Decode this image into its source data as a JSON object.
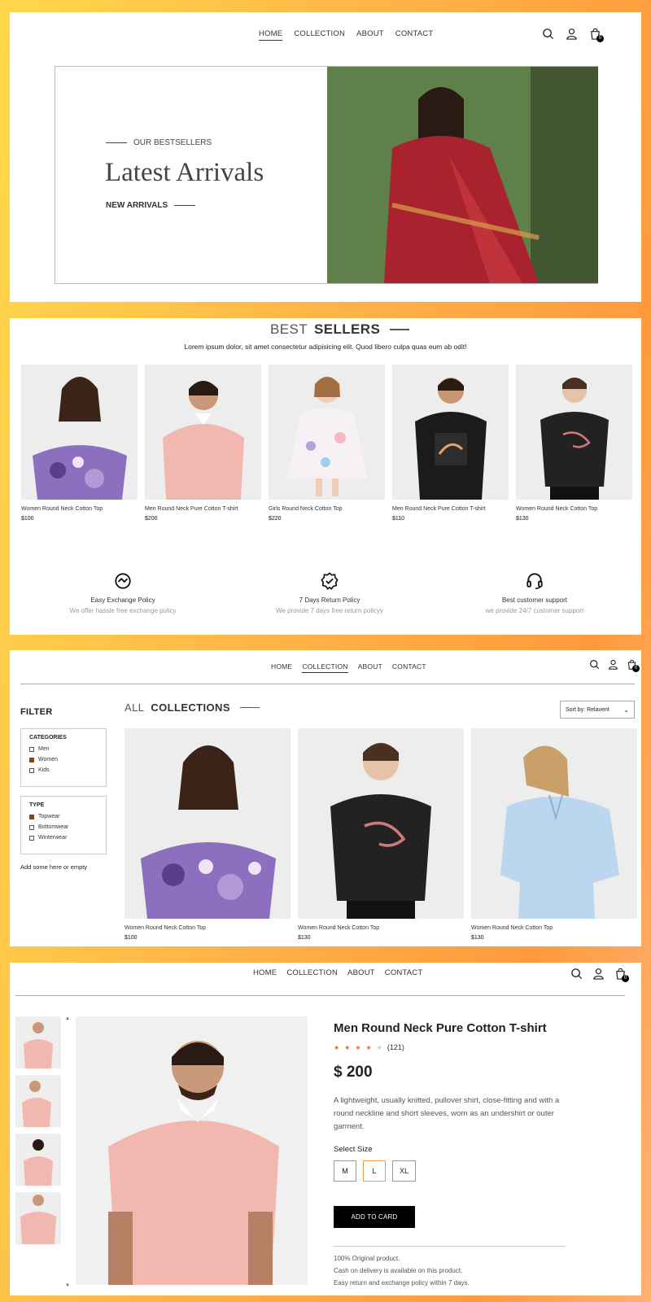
{
  "nav": {
    "home": "HOME",
    "collection": "COLLECTION",
    "about": "ABOUT",
    "contact": "CONTACT",
    "cart_count": "0"
  },
  "hero": {
    "eyebrow": "OUR BESTSELLERS",
    "title": "Latest Arrivals",
    "subtitle": "NEW ARRIVALS"
  },
  "bestsellers": {
    "title_light": "BEST",
    "title_bold": "SELLERS",
    "description": "Lorem ipsum dolor, sit amet consectetur adipisicing elit. Quod libero culpa quas eum ab odit!",
    "products": [
      {
        "name": "Women Round Neck Cotton Top",
        "price": "$100"
      },
      {
        "name": "Men Round Neck Pure Cotton T-shirt",
        "price": "$200"
      },
      {
        "name": "Girls Round Neck Cotton Top",
        "price": "$220"
      },
      {
        "name": "Men Round Neck Pure Cotton T-shirt",
        "price": "$110"
      },
      {
        "name": "Women Round Neck Cotton Top",
        "price": "$130"
      }
    ]
  },
  "policies": [
    {
      "title": "Easy Exchange Policy",
      "desc": "We offer hassle free exchange policy",
      "icon": "exchange-icon"
    },
    {
      "title": "7 Days Return Policy",
      "desc": "We provide 7 days free return policyy",
      "icon": "quality-badge-icon"
    },
    {
      "title": "Best customer support",
      "desc": "we provide 24/7 customer support",
      "icon": "headset-icon"
    }
  ],
  "collections": {
    "filter_title": "FILTER",
    "categories_title": "CATEGORIES",
    "categories": [
      {
        "label": "Men",
        "checked": false
      },
      {
        "label": "Women",
        "checked": true
      },
      {
        "label": "Kids",
        "checked": false
      }
    ],
    "type_title": "TYPE",
    "types": [
      {
        "label": "Topwear",
        "checked": true
      },
      {
        "label": "Bottomwear",
        "checked": false
      },
      {
        "label": "Winterwear",
        "checked": false
      }
    ],
    "note": "Add some here or empty",
    "title_light": "ALL",
    "title_bold": "COLLECTIONS",
    "sort_label": "Sort by: Relavent",
    "products": [
      {
        "name": "Women Round Neck Cotton Top",
        "price": "$100"
      },
      {
        "name": "Women Round Neck Cotton Top",
        "price": "$130"
      },
      {
        "name": "Women Round Neck Cotton Top",
        "price": "$130"
      }
    ]
  },
  "product": {
    "title": "Men Round Neck Pure Cotton T-shirt",
    "rating": 4,
    "rating_count": "(121)",
    "price": "$ 200",
    "description": "A lightweight, usually knitted, pullover shirt, close-fitting and with a round neckline and short sleeves, worn as an undershirt or outer garment.",
    "size_title": "Select Size",
    "sizes": [
      "M",
      "L",
      "XL"
    ],
    "selected_size": "L",
    "add_button": "ADD TO CARD",
    "notes": [
      "100% Original product.",
      "Cash on delivery is available on this product.",
      "Easy return and exchange policy within 7 days."
    ]
  },
  "colors": {
    "accent": "#f0a040",
    "star": "#e06a4a",
    "checkbox": "#7a4a1a"
  }
}
